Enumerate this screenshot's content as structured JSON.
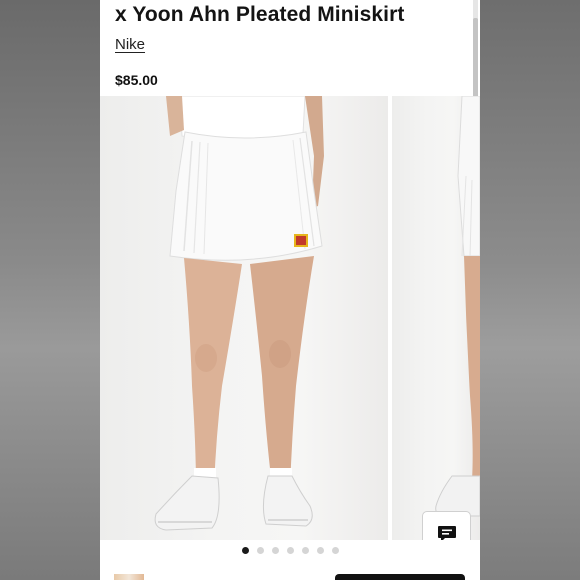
{
  "product": {
    "title": "x Yoon Ahn Pleated Miniskirt",
    "brand": "Nike",
    "price": "$85.00"
  },
  "gallery": {
    "image_count": 7,
    "active_index": 0,
    "main_image_alt_icon": "product-photo",
    "chat_icon": "chat-bubble-icon"
  },
  "colors": {
    "accent": "#111111",
    "page_bg": "#ffffff",
    "photo_bg": "#f2f2f1"
  }
}
